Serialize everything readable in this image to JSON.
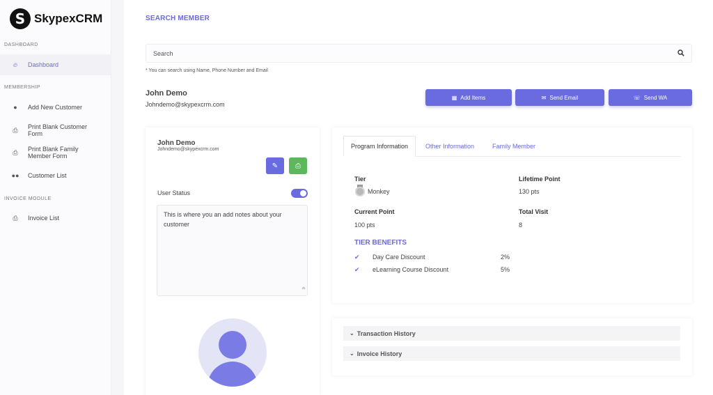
{
  "brand": {
    "logo_letter": "S",
    "name": "SkypexCRM"
  },
  "sidebar": {
    "sections": [
      {
        "label": "DASHBOARD"
      },
      {
        "label": "MEMBERSHIP"
      },
      {
        "label": "INVOICE MODULE"
      }
    ],
    "items": [
      {
        "label": "Dashboard",
        "icon": "fire-icon",
        "active": true
      },
      {
        "label": "Add New Customer",
        "icon": "user-icon"
      },
      {
        "label": "Print Blank Customer Form",
        "icon": "printer-icon"
      },
      {
        "label": "Print Blank Family Member Form",
        "icon": "printer-icon"
      },
      {
        "label": "Customer List",
        "icon": "users-icon"
      },
      {
        "label": "Invoice List",
        "icon": "printer-icon"
      }
    ]
  },
  "page": {
    "title": "SEARCH MEMBER",
    "search_placeholder": "Search",
    "search_hint": "* You can search using Name, Phone Number and Email"
  },
  "member": {
    "name": "John Demo",
    "email": "Johndemo@skypexcrm.com"
  },
  "actions": {
    "add_items": "Add Items",
    "send_email": "Send Email",
    "send_wa": "Send WA"
  },
  "profile_card": {
    "name": "John Demo",
    "email": "Johndemo@skypexcrm.com",
    "status_label": "User Status",
    "status_on": true,
    "notes": "This is where you an add notes about your customer"
  },
  "tabs": [
    {
      "label": "Program Information",
      "active": true
    },
    {
      "label": "Other Information"
    },
    {
      "label": "Family Member"
    }
  ],
  "program": {
    "tier_label": "Tier",
    "tier_value": "Monkey",
    "lifetime_label": "Lifetime Point",
    "lifetime_value": "130 pts",
    "current_label": "Current Point",
    "current_value": "100 pts",
    "visit_label": "Total Visit",
    "visit_value": "8",
    "benefits_title": "TIER BENEFITS",
    "benefits": [
      {
        "name": "Day Care Discount",
        "value": "2%"
      },
      {
        "name": "eLearning Course Discount",
        "value": "5%"
      }
    ]
  },
  "history": {
    "transaction": "Transaction History",
    "invoice": "Invoice History"
  },
  "colors": {
    "accent": "#6b6be0",
    "success": "#5cb85c"
  }
}
